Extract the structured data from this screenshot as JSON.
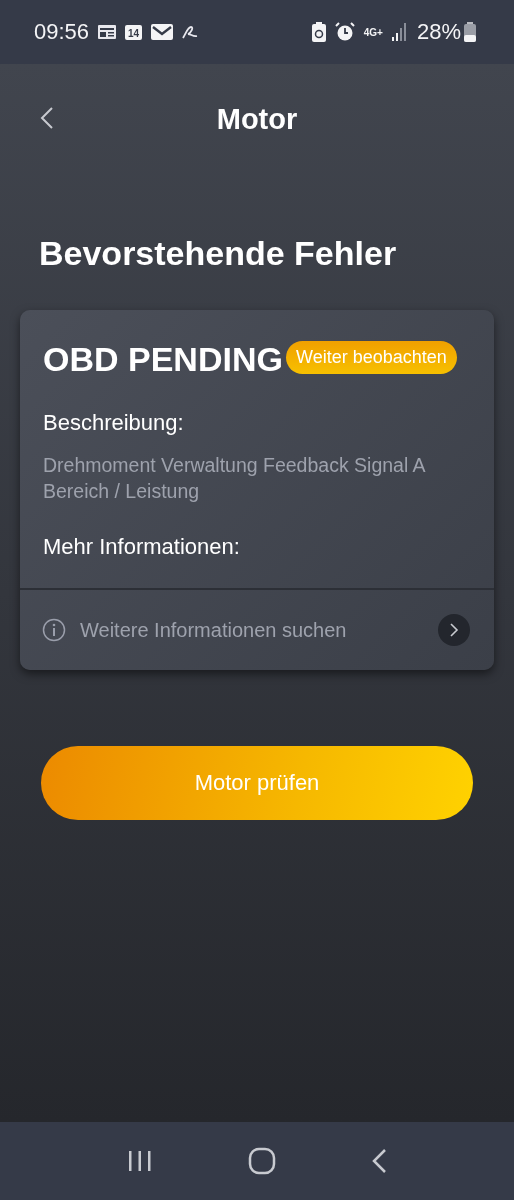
{
  "status_bar": {
    "time": "09:56",
    "calendar_day": "14",
    "network": "4G+",
    "battery": "28%"
  },
  "header": {
    "title": "Motor"
  },
  "section_title": "Bevorstehende Fehler",
  "card": {
    "code": "OBD PENDING",
    "badge": "Weiter beobachten",
    "description_label": "Beschreibung:",
    "description": "Drehmoment Verwaltung Feedback Signal A Bereich / Leistung",
    "more_label": "Mehr Informationen:",
    "search_link": "Weitere Informationen suchen"
  },
  "primary_button": "Motor prüfen"
}
